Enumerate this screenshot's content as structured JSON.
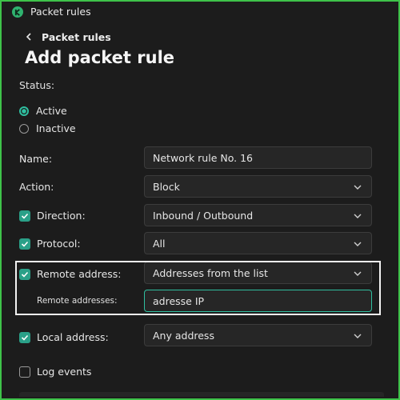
{
  "window": {
    "title": "Packet rules"
  },
  "breadcrumb": {
    "back_label": "Packet rules"
  },
  "page": {
    "title": "Add packet rule"
  },
  "status": {
    "label": "Status:",
    "options": [
      "Active",
      "Inactive"
    ],
    "selected": "Active"
  },
  "form": {
    "name": {
      "label": "Name:",
      "value": "Network rule No. 16"
    },
    "action": {
      "label": "Action:",
      "value": "Block"
    },
    "direction": {
      "label": "Direction:",
      "checked": true,
      "value": "Inbound / Outbound"
    },
    "protocol": {
      "label": "Protocol:",
      "checked": true,
      "value": "All"
    },
    "remote_address": {
      "label": "Remote address:",
      "checked": true,
      "value": "Addresses from the list"
    },
    "remote_addresses": {
      "label": "Remote addresses:",
      "value": "adresse IP"
    },
    "local_address": {
      "label": "Local address:",
      "checked": true,
      "value": "Any address"
    },
    "log_events": {
      "label": "Log events",
      "checked": false
    }
  },
  "colors": {
    "accent": "#2fbfa0",
    "frame": "#3ec24a",
    "background": "#1c1c1c"
  }
}
